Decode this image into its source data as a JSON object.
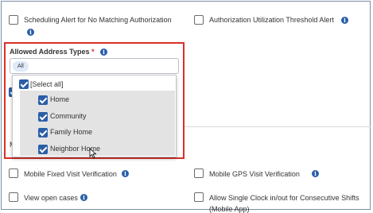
{
  "top_options": {
    "scheduling_alert": "Scheduling Alert for No Matching Authorization",
    "authorization_threshold": "Authorization Utilization Threshold Alert"
  },
  "address_types": {
    "label": "Allowed Address Types",
    "required_mark": "*",
    "selected_chip": "All",
    "select_all": "[Select all]",
    "options": [
      "Home",
      "Community",
      "Family Home",
      "Neighbor Home"
    ]
  },
  "hidden_label_fragment": "M",
  "bottom_options": {
    "mobile_fixed": "Mobile Fixed Visit Verification",
    "mobile_gps": "Mobile GPS Visit Verification",
    "view_open_cases": "View open cases",
    "single_clock": "Allow Single Clock in/out for Consecutive Shifts",
    "single_clock_suffix": "(Mobile App)"
  },
  "colors": {
    "accent": "#2a5ea8",
    "highlight_border": "#d9302a"
  }
}
